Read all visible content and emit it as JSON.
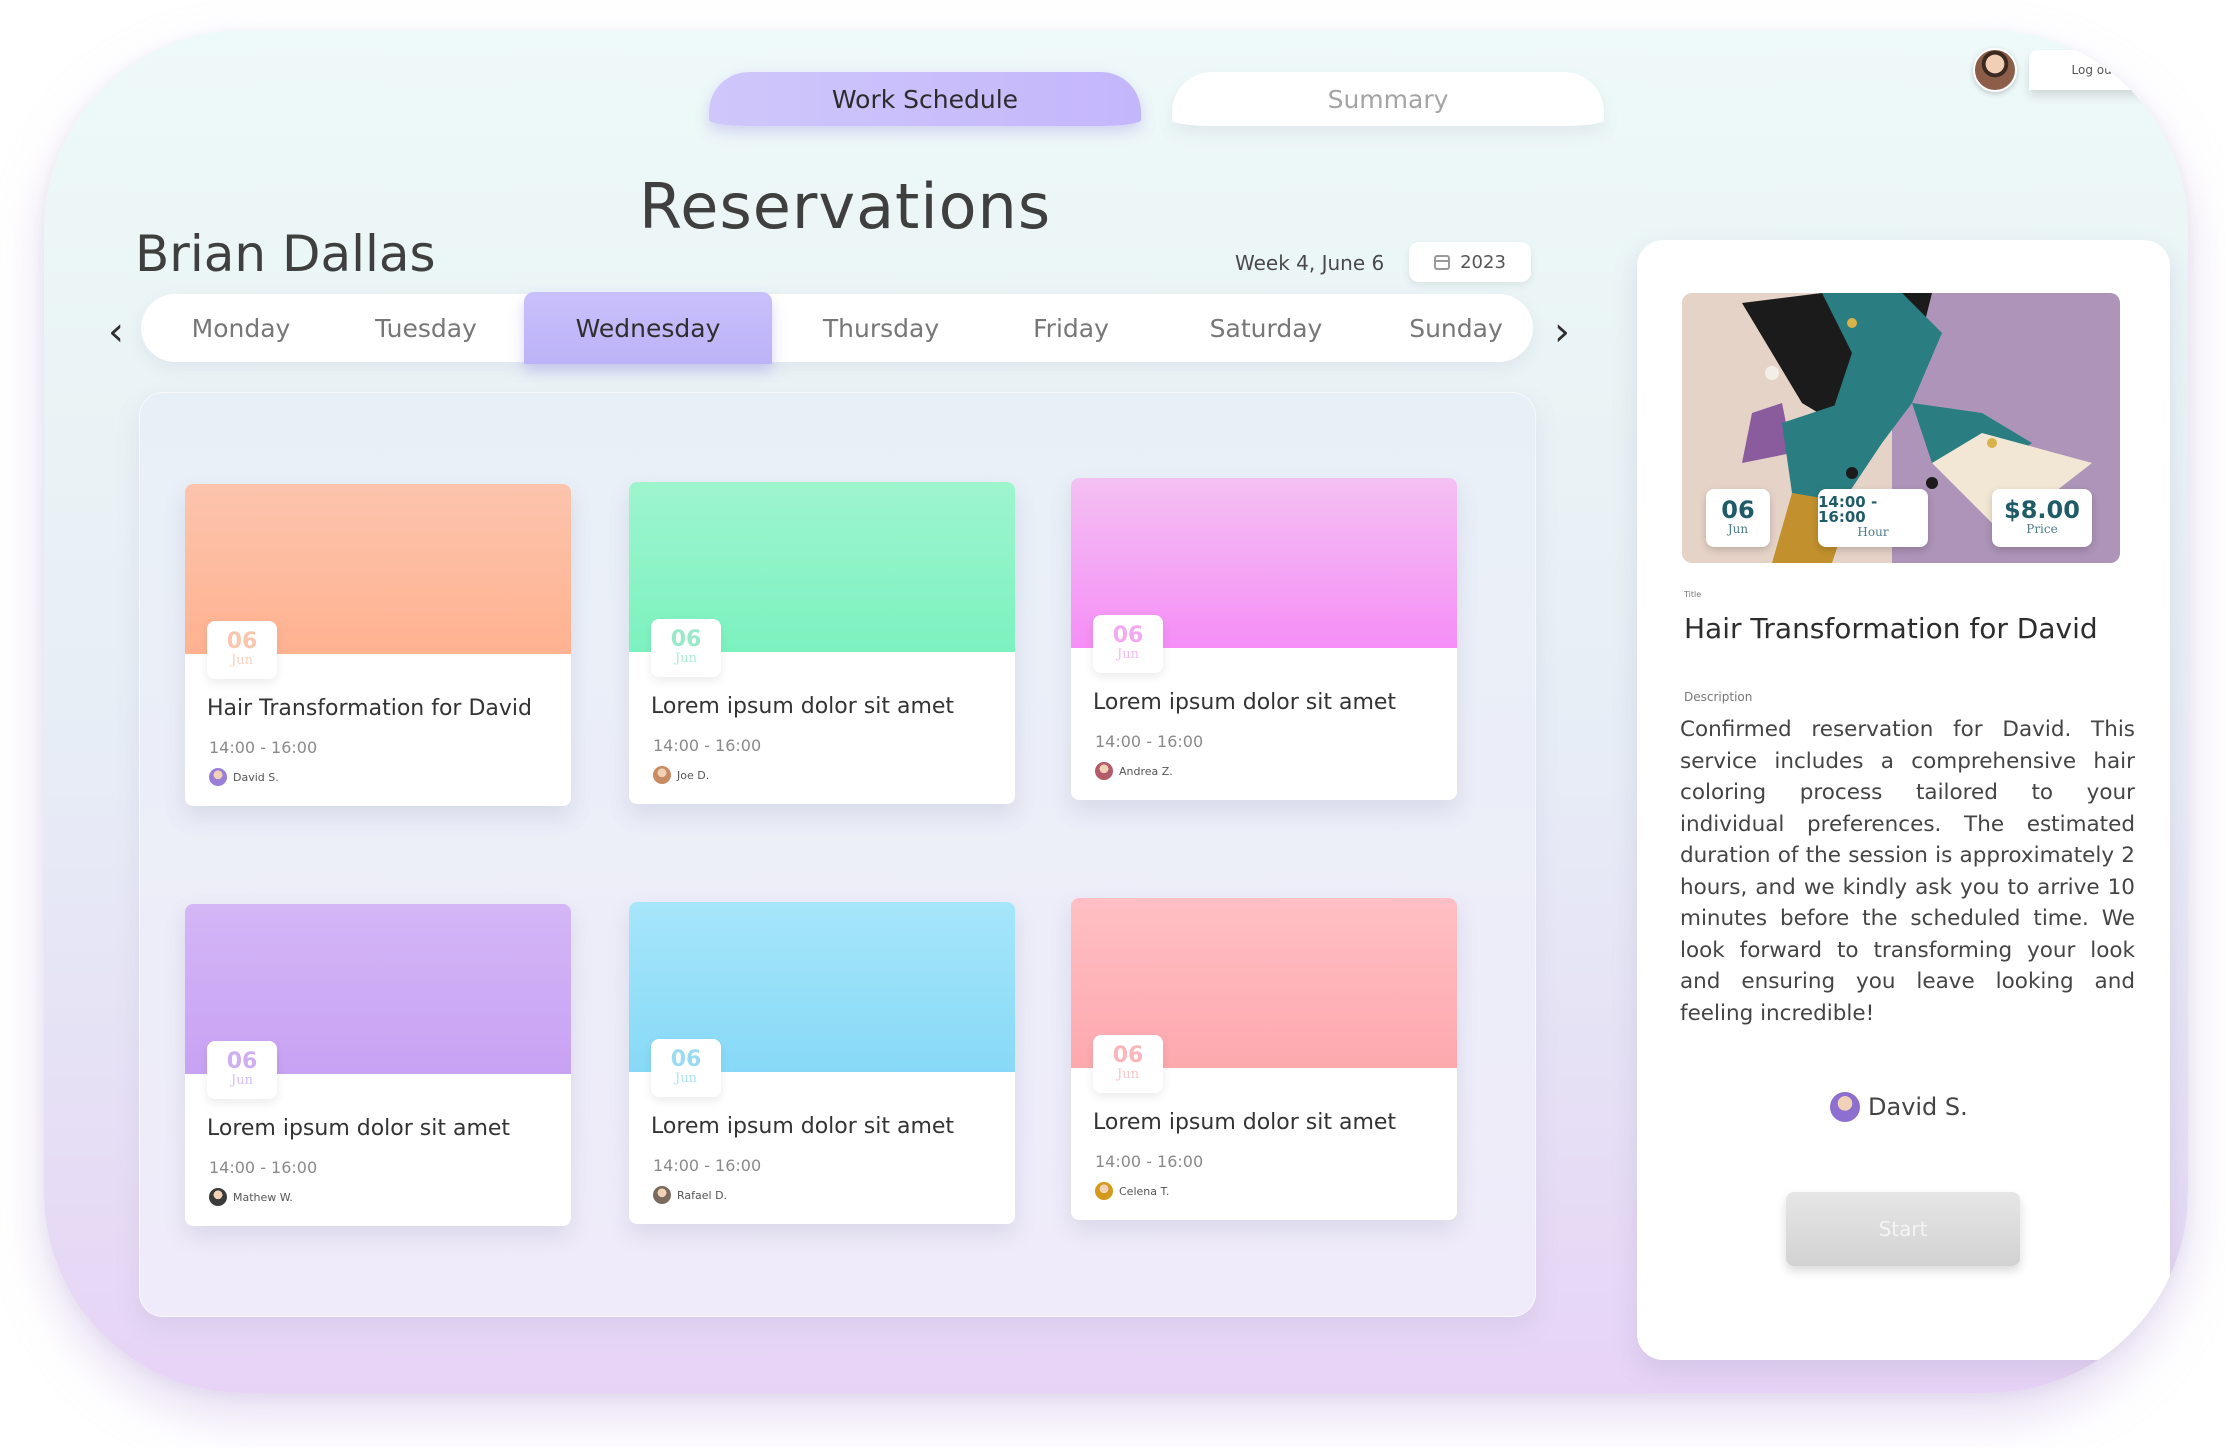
{
  "tabs": {
    "work_schedule": "Work Schedule",
    "summary": "Summary"
  },
  "header": {
    "logout": "Log out",
    "title": "Reservations",
    "user_name": "Brian Dallas",
    "week": "Week 4, June 6",
    "year": "2023"
  },
  "days": [
    "Monday",
    "Tuesday",
    "Wednesday",
    "Thursday",
    "Friday",
    "Saturday",
    "Sunday"
  ],
  "active_day": "Wednesday",
  "cards": [
    {
      "day": "06",
      "month": "Jun",
      "title": "Hair Transformation for David",
      "time": "14:00 - 16:00",
      "person": "David S.",
      "color_top": "#fcc4ad",
      "color_bottom": "#ffb290",
      "accent": "#f59a6e",
      "avatar": "#9b7fd6"
    },
    {
      "day": "06",
      "month": "Jun",
      "title": "Lorem ipsum dolor sit amet",
      "time": "14:00 - 16:00",
      "person": "Joe D.",
      "color_top": "#9ef5cd",
      "color_bottom": "#7cf2bf",
      "accent": "#48d6a0",
      "avatar": "#c98b62"
    },
    {
      "day": "06",
      "month": "Jun",
      "title": "Lorem ipsum dolor sit amet",
      "time": "14:00 - 16:00",
      "person": "Andrea Z.",
      "color_top": "#f4c0f2",
      "color_bottom": "#f58ef6",
      "accent": "#ea63e8",
      "avatar": "#b45b6a"
    },
    {
      "day": "06",
      "month": "Jun",
      "title": "Lorem ipsum dolor sit amet",
      "time": "14:00 - 16:00",
      "person": "Mathew W.",
      "color_top": "#d4b6f6",
      "color_bottom": "#c8a2f4",
      "accent": "#a66fe8",
      "avatar": "#3b3b3b"
    },
    {
      "day": "06",
      "month": "Jun",
      "title": "Lorem ipsum dolor sit amet",
      "time": "14:00 - 16:00",
      "person": "Rafael D.",
      "color_top": "#a6e6fa",
      "color_bottom": "#87d9f7",
      "accent": "#4bbfe8",
      "avatar": "#7a6b5e"
    },
    {
      "day": "06",
      "month": "Jun",
      "title": "Lorem ipsum dolor sit amet",
      "time": "14:00 - 16:00",
      "person": "Celena T.",
      "color_top": "#ffbfc4",
      "color_bottom": "#fda9ae",
      "accent": "#f67b84",
      "avatar": "#d49a1c"
    }
  ],
  "detail": {
    "day": "06",
    "month": "Jun",
    "time": "14:00 - 16:00",
    "time_label": "Hour",
    "price": "$8.00",
    "price_label": "Price",
    "title_label": "Title",
    "title": "Hair Transformation for David",
    "description_label": "Description",
    "description": "Confirmed reservation for David. This service includes a comprehensive hair coloring process tailored to your individual preferences. The estimated duration of the session is approximately 2 hours, and we kindly ask you to arrive 10 minutes before the scheduled time. We look forward to transforming your look and ensuring you leave looking and feeling incredible!",
    "person": "David S.",
    "start": "Start"
  },
  "icons": [
    "chevron-left-icon",
    "chevron-right-icon",
    "calendar-icon",
    "user-avatar"
  ]
}
